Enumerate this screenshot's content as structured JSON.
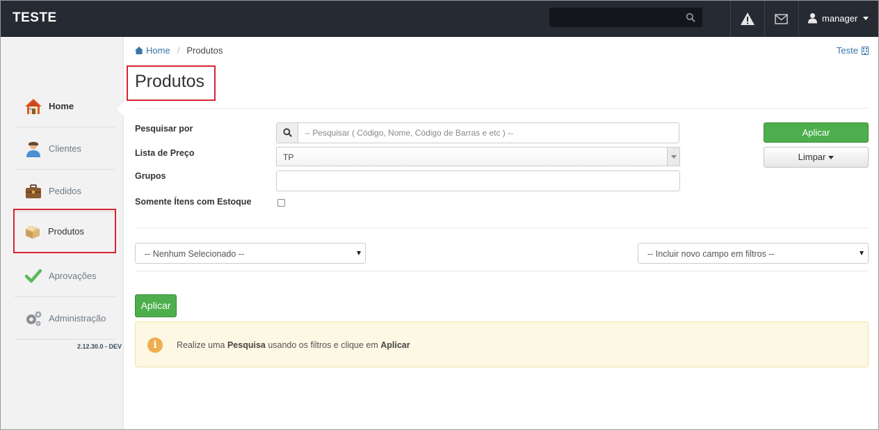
{
  "app": {
    "brand": "TESTE"
  },
  "topbar": {
    "search_placeholder": "",
    "icons": [
      "search-icon",
      "warning-icon",
      "envelope-icon",
      "user-icon"
    ],
    "user_name": "manager"
  },
  "sidebar": {
    "items": [
      {
        "label": "Home",
        "icon": "home-icon",
        "active": true
      },
      {
        "label": "Clientes",
        "icon": "user-icon"
      },
      {
        "label": "Pedidos",
        "icon": "briefcase-icon"
      },
      {
        "label": "Produtos",
        "icon": "box-icon"
      },
      {
        "label": "Aprovações",
        "icon": "checkmark-icon"
      },
      {
        "label": "Administração",
        "icon": "gears-icon"
      }
    ],
    "version": "2.12.30.0 - DEV"
  },
  "breadcrumb": {
    "home": "Home",
    "separator": "/",
    "current": "Produtos"
  },
  "header_link": "Teste",
  "page": {
    "title": "Produtos"
  },
  "filters": {
    "search_label": "Pesquisar por",
    "search_placeholder": "-- Pesquisar ( Código, Nome, Código de Barras e etc ) --",
    "price_list_label": "Lista de Preço",
    "price_list_value": "TP",
    "groups_label": "Grupos",
    "groups_value": "",
    "stock_only_label": "Somente Ítens com Estoque",
    "stock_only_checked": false
  },
  "buttons": {
    "apply": "Aplicar",
    "clear": "Limpar",
    "apply_main": "Aplicar"
  },
  "selects": {
    "left": "-- Nenhum Selecionado --",
    "right": "-- Incluir novo campo em filtros --"
  },
  "alert": {
    "icon": "i",
    "prefix": "Realize uma ",
    "bold1": "Pesquisa",
    "middle": " usando os filtros e clique em ",
    "bold2": "Aplicar"
  },
  "colors": {
    "navbar": "#262a33",
    "success": "#4cae4c",
    "alert_bg": "#fcf8e3",
    "highlight": "#d6262f",
    "link": "#3a75a8"
  }
}
